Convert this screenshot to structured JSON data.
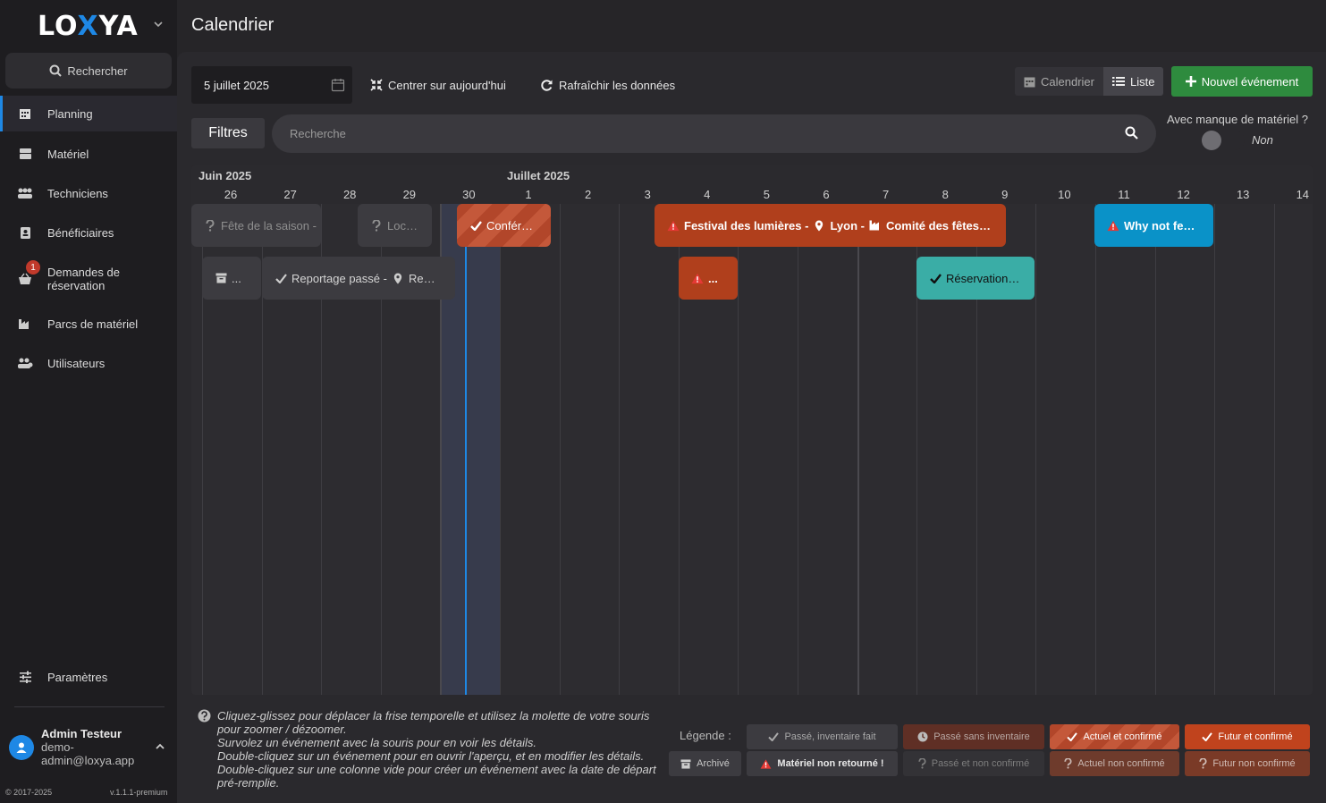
{
  "sidebar": {
    "logo_left": "LO",
    "logo_x": "X",
    "logo_right": "YA",
    "search_label": "Rechercher",
    "items": [
      {
        "label": "Planning",
        "icon": "calendar-icon",
        "active": true
      },
      {
        "label": "Matériel",
        "icon": "box-icon"
      },
      {
        "label": "Techniciens",
        "icon": "people-icon"
      },
      {
        "label": "Bénéficiaires",
        "icon": "contact-book-icon"
      },
      {
        "label": "Demandes de réservation",
        "icon": "basket-icon",
        "badge": "1"
      },
      {
        "label": "Parcs de matériel",
        "icon": "industry-icon"
      },
      {
        "label": "Utilisateurs",
        "icon": "users-icon"
      }
    ],
    "settings_label": "Paramètres",
    "user": {
      "name": "Admin Testeur",
      "email": "demo-admin@loxya.app"
    },
    "copyright": "© 2017-2025",
    "version": "v.1.1.1-premium"
  },
  "header": {
    "title": "Calendrier"
  },
  "toolbar": {
    "date_value": "5 juillet 2025",
    "center_today": "Centrer sur aujourd'hui",
    "refresh": "Rafraîchir les données",
    "view_calendar": "Calendrier",
    "view_list": "Liste",
    "new_event": "Nouvel événement",
    "filters": "Filtres",
    "search_placeholder": "Recherche",
    "lack_label": "Avec manque de matériel ?",
    "lack_value": "Non"
  },
  "timeline": {
    "months": [
      "Juin 2025",
      "Juillet 2025"
    ],
    "days": [
      "26",
      "27",
      "28",
      "29",
      "30",
      "1",
      "2",
      "3",
      "4",
      "5",
      "6",
      "7",
      "8",
      "9",
      "10",
      "11",
      "12",
      "13",
      "14"
    ],
    "events": [
      {
        "text": "Fête de la saison -",
        "icon": "question-icon"
      },
      {
        "text": "Loc…",
        "icon": "question-icon"
      },
      {
        "text": "Confér…",
        "icon": "check-icon"
      },
      {
        "text_parts": [
          "Festival des lumières -",
          "Lyon -",
          "Comité des fêtes…"
        ],
        "icon": "warning-icon"
      },
      {
        "text": "Why not fe…",
        "icon": "warning-icon"
      },
      {
        "text": "...",
        "icon": "archive-icon"
      },
      {
        "text_parts": [
          "Reportage passé -",
          "Re…"
        ],
        "icon": "check-icon"
      },
      {
        "text": "...",
        "icon": "warning-icon"
      },
      {
        "text": "Réservation…",
        "icon": "check-icon"
      }
    ]
  },
  "help": {
    "lines": [
      "Cliquez-glissez pour déplacer la frise temporelle et utilisez la molette de votre souris pour zoomer / dézoomer.",
      "Survolez un événement avec la souris pour en voir les détails.",
      "Double-cliquez sur un événement pour en ouvrir l'aperçu, et en modifier les détails.",
      "Double-cliquez sur une colonne vide pour créer un événement avec la date de départ pré-remplie."
    ]
  },
  "legend": {
    "label": "Légende :",
    "items": [
      {
        "label": "Passé, inventaire fait",
        "icon": "check-icon"
      },
      {
        "label": "Passé sans inventaire",
        "icon": "clock-icon"
      },
      {
        "label": "Actuel et confirmé",
        "icon": "check-icon"
      },
      {
        "label": "Futur et confirmé",
        "icon": "check-icon"
      },
      {
        "label": "Archivé",
        "icon": "archive-icon"
      },
      {
        "label": "Matériel non retourné !",
        "icon": "warning-icon"
      },
      {
        "label": "Passé et non confirmé",
        "icon": "question-icon"
      },
      {
        "label": "Actuel non confirmé",
        "icon": "question-icon"
      },
      {
        "label": "Futur non confirmé",
        "icon": "question-icon"
      }
    ]
  },
  "colors": {
    "accent": "#1e88e5",
    "success": "#2e8b3e",
    "warning": "#b03f1c",
    "info": "#0a92c8",
    "teal": "#3aada6"
  }
}
